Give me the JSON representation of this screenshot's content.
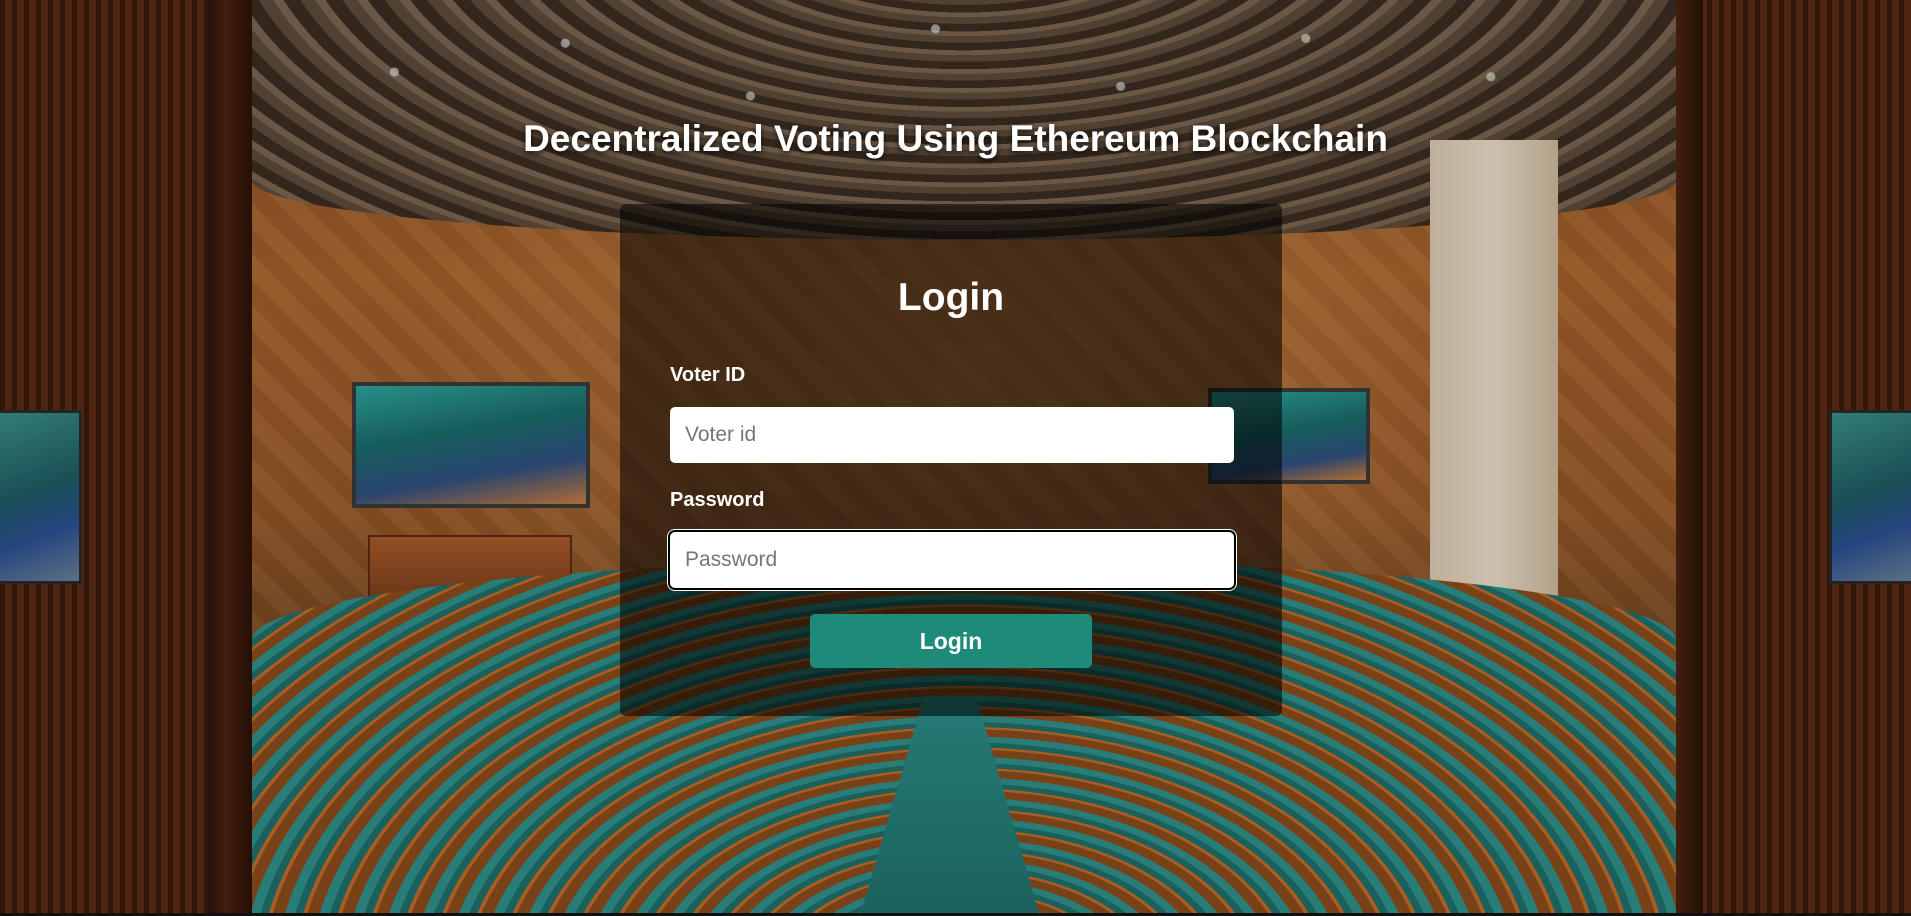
{
  "header": {
    "title": "Decentralized Voting Using Ethereum Blockchain"
  },
  "login_form": {
    "heading": "Login",
    "voter_id": {
      "label": "Voter ID",
      "placeholder": "Voter id",
      "value": ""
    },
    "password": {
      "label": "Password",
      "placeholder": "Password",
      "value": ""
    },
    "submit_label": "Login"
  },
  "colors": {
    "button_background": "#1e8a7a",
    "card_overlay": "rgba(0,0,0,0.55)",
    "text": "#ffffff"
  }
}
